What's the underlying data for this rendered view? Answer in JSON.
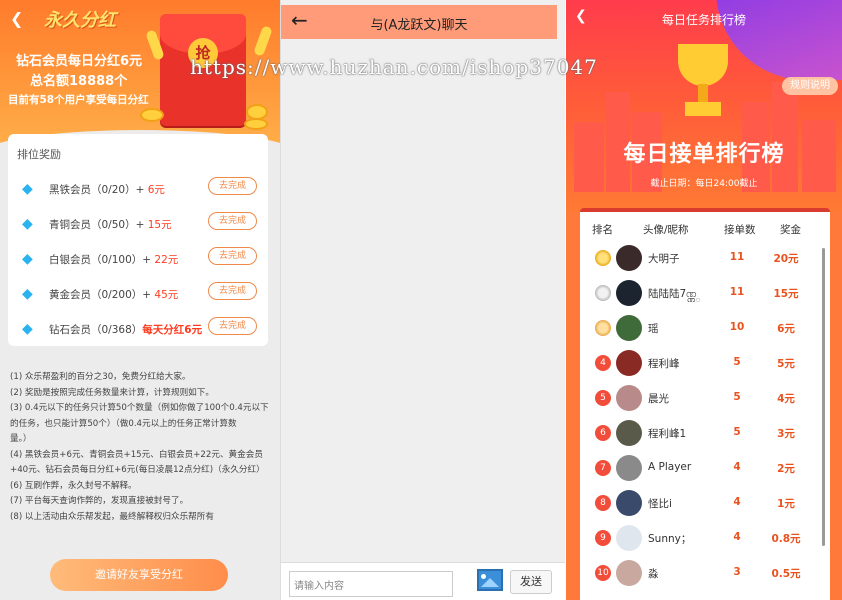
{
  "panel1": {
    "back_icon": "chevron-left-icon",
    "permanent_title": "永久分红",
    "line1": "钻石会员每日分红6元",
    "line2": "总名额18888个",
    "line3": "目前有58个用户享受每日分红",
    "seal_text": "抢",
    "card_title": "排位奖励",
    "rewards": [
      {
        "name": "黑铁会员（0/20）+",
        "amount": " 6元",
        "button": "去完成"
      },
      {
        "name": "青铜会员（0/50）+",
        "amount": " 15元",
        "button": "去完成"
      },
      {
        "name": "白银会员（0/100）+",
        "amount": " 22元",
        "button": "去完成"
      },
      {
        "name": "黄金会员（0/200）+",
        "amount": " 45元",
        "button": "去完成"
      },
      {
        "name": "钻石会员（0/368）",
        "amount": "每天分红6元",
        "button": "去完成"
      }
    ],
    "rules": [
      "(1) 众乐帮盈利的百分之30，免费分红给大家。",
      "(2) 奖励是按照完成任务数量来计算，计算规则如下。",
      "(3) 0.4元以下的任务只计算50个数量（例如你做了100个0.4元以下",
      "的任务，也只能计算50个）（做0.4元以上的任务正常计算数",
      "量。）",
      "(4) 黑铁会员+6元、青铜会员+15元、白银会员+22元、黄金会员",
      "+40元、钻石会员每日分红+6元(每日凌晨12点分红)（永久分红）",
      "(6) 互刷作弊，永久封号不解释。",
      "(7) 平台每天查询作弊的，发现直接被封号了。",
      "(8) 以上活动由众乐帮发起，最终解释权归众乐帮所有"
    ],
    "invite_label": "邀请好友享受分红"
  },
  "panel2": {
    "back_icon": "arrow-left-icon",
    "title": "与(A龙跃文)聊天",
    "input_placeholder": "请输入内容",
    "image_icon": "image-icon",
    "send_label": "发送"
  },
  "panel3": {
    "back_icon": "chevron-left-icon",
    "title": "每日任务排行榜",
    "rule_label": "规则说明",
    "big_title": "每日接单排行榜",
    "deadline": "截止日期：每日24:00截止",
    "headers": {
      "rank": "排名",
      "avatar": "头像/昵称",
      "count": "接单数",
      "reward": "奖金"
    },
    "rows": [
      {
        "rank": "1",
        "name": "大明子",
        "count": "11",
        "reward": "20元"
      },
      {
        "rank": "2",
        "name": "陆陆陆7ဏ္ဏ္",
        "count": "11",
        "reward": "15元"
      },
      {
        "rank": "3",
        "name": "瑶",
        "count": "10",
        "reward": "6元"
      },
      {
        "rank": "4",
        "name": "程利峰",
        "count": "5",
        "reward": "5元"
      },
      {
        "rank": "5",
        "name": "晨光",
        "count": "5",
        "reward": "4元"
      },
      {
        "rank": "6",
        "name": "程利峰1",
        "count": "5",
        "reward": "3元"
      },
      {
        "rank": "7",
        "name": "A Player",
        "count": "4",
        "reward": "2元"
      },
      {
        "rank": "8",
        "name": "怪比i",
        "count": "4",
        "reward": "1元"
      },
      {
        "rank": "9",
        "name": "Sunny；",
        "count": "4",
        "reward": "0.8元"
      },
      {
        "rank": "10",
        "name": "淼",
        "count": "3",
        "reward": "0.5元"
      }
    ]
  },
  "watermark": "https://www.huzhan.com/ishop37047",
  "colors": {
    "accent": "#ff7b2c",
    "chat_header": "#ff9b78",
    "rank_red": "#f24c3a",
    "reward_red": "#e8531f"
  }
}
